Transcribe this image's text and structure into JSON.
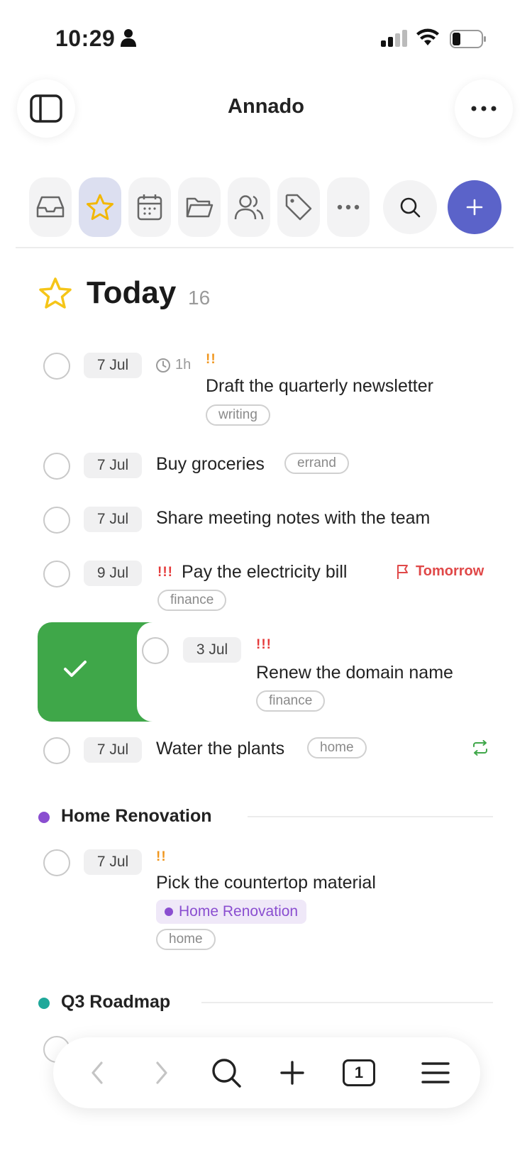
{
  "status_bar": {
    "time": "10:29"
  },
  "header": {
    "title": "Annado"
  },
  "today": {
    "title": "Today",
    "count": "16"
  },
  "tasks": [
    {
      "date": "7 Jul",
      "duration": "1h",
      "priority": "!!",
      "title": "Draft the quarterly newsletter",
      "tag": "writing"
    },
    {
      "date": "7 Jul",
      "title": "Buy groceries",
      "tag": "errand"
    },
    {
      "date": "7 Jul",
      "title": "Share meeting notes with the team"
    },
    {
      "date": "9 Jul",
      "priority": "!!!",
      "title": "Pay the electricity bill",
      "due": "Tomorrow",
      "tag": "finance"
    },
    {
      "date": "3 Jul",
      "priority": "!!!",
      "title": "Renew the domain name",
      "tag": "finance"
    },
    {
      "date": "7 Jul",
      "title": "Water the plants",
      "tag": "home"
    }
  ],
  "sections": [
    {
      "title": "Home Renovation",
      "color": "#8a4ed0",
      "tasks": [
        {
          "date": "7 Jul",
          "priority": "!!",
          "title": "Pick the countertop material",
          "project": "Home Renovation",
          "tag": "home"
        }
      ]
    },
    {
      "title": "Q3 Roadmap",
      "color": "#1fa89a"
    }
  ],
  "browser_bar": {
    "tab_count": "1"
  },
  "colors": {
    "accent": "#5b63c9",
    "complete": "#3fa749",
    "priority_high": "#e53a3a",
    "priority_medium": "#f0961e",
    "star": "#f5c518"
  }
}
